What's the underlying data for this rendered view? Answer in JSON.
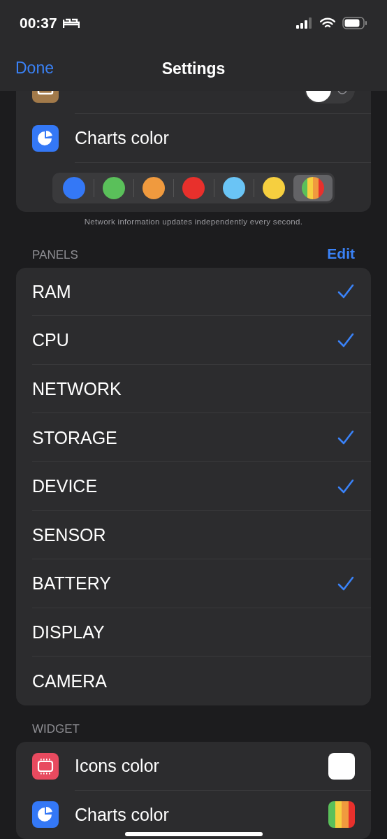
{
  "status_bar": {
    "time": "00:37"
  },
  "nav": {
    "done": "Done",
    "title": "Settings"
  },
  "general": {
    "rows": [
      {
        "kind": "toggle",
        "on": false
      },
      {
        "kind": "plain",
        "label": "Charts color"
      }
    ],
    "swatches": [
      {
        "kind": "solid",
        "color": "#3478f6",
        "selected": false
      },
      {
        "kind": "solid",
        "color": "#5ac05a",
        "selected": false
      },
      {
        "kind": "solid",
        "color": "#f09a3e",
        "selected": false
      },
      {
        "kind": "solid",
        "color": "#e8302c",
        "selected": false
      },
      {
        "kind": "solid",
        "color": "#6ac4f5",
        "selected": false
      },
      {
        "kind": "solid",
        "color": "#f6cf3f",
        "selected": false
      },
      {
        "kind": "multi",
        "selected": true
      }
    ],
    "footer": "Network information updates independently every second."
  },
  "panels": {
    "header": "PANELS",
    "edit": "Edit",
    "items": [
      {
        "label": "RAM",
        "checked": true
      },
      {
        "label": "CPU",
        "checked": true
      },
      {
        "label": "NETWORK",
        "checked": false
      },
      {
        "label": "STORAGE",
        "checked": true
      },
      {
        "label": "DEVICE",
        "checked": true
      },
      {
        "label": "SENSOR",
        "checked": false
      },
      {
        "label": "BATTERY",
        "checked": true
      },
      {
        "label": "DISPLAY",
        "checked": false
      },
      {
        "label": "CAMERA",
        "checked": false
      }
    ]
  },
  "widget": {
    "header": "WIDGET",
    "rows": [
      {
        "label": "Icons color",
        "kind": "solid",
        "color": "#ffffff"
      },
      {
        "label": "Charts color",
        "kind": "multi"
      }
    ]
  }
}
